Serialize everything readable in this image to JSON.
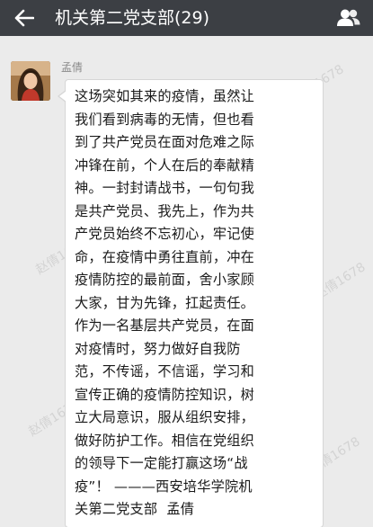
{
  "header": {
    "title": "机关第二党支部(29)",
    "back_icon": "arrow-left-icon",
    "members_icon": "group-members-icon",
    "background_color": "#3c3f44"
  },
  "message": {
    "sender_name": "孟倩",
    "avatar_icon": "user-avatar-photo",
    "lines": [
      "这场突如其来的疫情，虽然让",
      "我们看到病毒的无情，但也看",
      "到了共产党员在面对危难之际",
      "冲锋在前，个人在后的奉献精",
      "神。一封封请战书，一句句我",
      "是共产党员、我先上，作为共",
      "产党员始终不忘初心，牢记使",
      "命，在疫情中勇往直前，冲在",
      "疫情防控的最前面，舍小家顾",
      "大家，甘为先锋，扛起责任。",
      "作为一名基层共产党员，在面",
      "对疫情时，努力做好自我防",
      "范，不传谣，不信谣，学习和",
      "宣传正确的疫情防控知识，树",
      "立大局意识，服从组织安排，",
      "做好防护工作。相信在党组织",
      "的领导下一定能打赢这场“战",
      "疫”！ ———西安培华学院机",
      "关第二党支部  孟倩"
    ]
  },
  "watermark": {
    "texts": [
      "赵倩1678",
      "赵倩1678",
      "赵倩1678",
      "赵倩1678",
      "赵倩1678",
      "赵倩1678"
    ]
  }
}
